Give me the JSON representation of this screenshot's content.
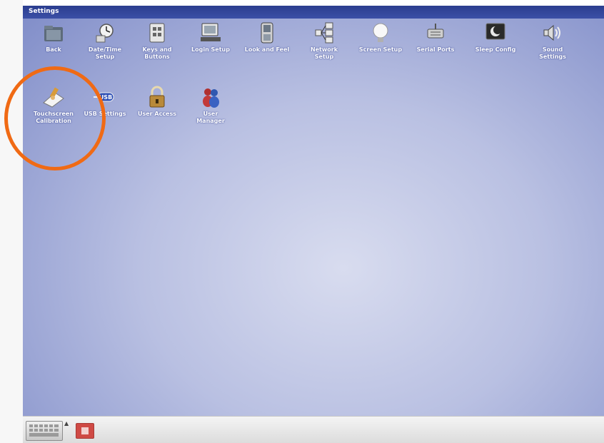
{
  "window": {
    "title": "Settings"
  },
  "icons": [
    {
      "label": "Back",
      "icon": "folder-back-icon"
    },
    {
      "label": "Date/Time\nSetup",
      "icon": "clock-icon"
    },
    {
      "label": "Keys and\nButtons",
      "icon": "keys-icon"
    },
    {
      "label": "Login Setup",
      "icon": "login-icon"
    },
    {
      "label": "Look and Feel",
      "icon": "look-feel-icon"
    },
    {
      "label": "Network\nSetup",
      "icon": "network-icon"
    },
    {
      "label": "Screen Setup",
      "icon": "lightbulb-icon"
    },
    {
      "label": "Serial Ports",
      "icon": "serial-port-icon"
    },
    {
      "label": "Sleep Config",
      "icon": "moon-monitor-icon"
    },
    {
      "label": "Sound\nSettings",
      "icon": "speaker-icon"
    },
    {
      "label": "Touchscreen\nCalibration",
      "icon": "touchscreen-icon"
    },
    {
      "label": "USB Settings",
      "icon": "usb-icon"
    },
    {
      "label": "User Access",
      "icon": "padlock-icon"
    },
    {
      "label": "User\nManager",
      "icon": "users-icon"
    }
  ],
  "taskbar": {
    "keyboard_button": "keyboard-icon",
    "app_button": "app-icon"
  },
  "colors": {
    "titlebar": "#2b3d8f",
    "desktop": "#b9c0e2",
    "highlight": "#f06a14",
    "taskbar": "#e8e8e8"
  }
}
